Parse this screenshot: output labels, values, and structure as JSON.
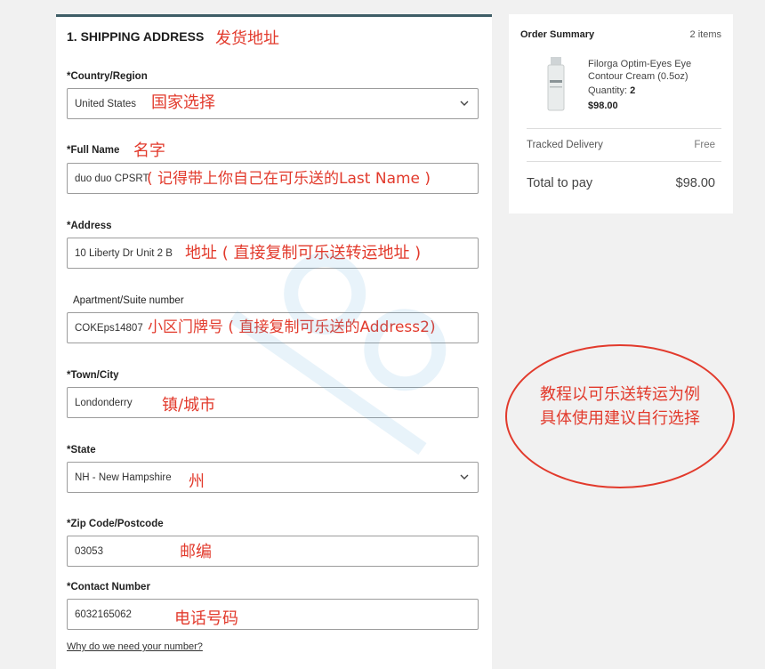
{
  "form": {
    "section_title": "1. SHIPPING ADDRESS",
    "country": {
      "label": "*Country/Region",
      "value": "United States"
    },
    "full_name": {
      "label": "*Full Name",
      "value": "duo duo  CPSRT"
    },
    "address": {
      "label": "*Address",
      "value": "10 Liberty Dr Unit 2 B"
    },
    "apartment": {
      "label": "Apartment/Suite number",
      "value": "COKEps14807"
    },
    "town": {
      "label": "*Town/City",
      "value": "Londonderry"
    },
    "state": {
      "label": "*State",
      "value": "NH - New Hampshire"
    },
    "zip": {
      "label": "*Zip Code/Postcode",
      "value": "03053"
    },
    "phone": {
      "label": "*Contact Number",
      "value": "6032165062"
    },
    "help_link": "Why do we need your number?"
  },
  "annotations": {
    "shipping": "发货地址",
    "country": "国家选择",
    "name": "名字",
    "name_hint": "( 记得带上你自己在可乐送的Last Name )",
    "address": "地址 ( 直接复制可乐送转运地址 )",
    "apartment": "小区门牌号 ( 直接复制可乐送的Address2)",
    "town": "镇/城市",
    "state": "州",
    "zip": "邮编",
    "phone": "电话号码",
    "oval_line1": "教程以可乐送转运为例",
    "oval_line2": "具体使用建议自行选择"
  },
  "summary": {
    "title": "Order Summary",
    "count": "2 items",
    "product_name": "Filorga Optim-Eyes Eye Contour Cream (0.5oz)",
    "quantity_label": "Quantity:",
    "quantity": "2",
    "price": "$98.00",
    "delivery_label": "Tracked Delivery",
    "delivery_value": "Free",
    "total_label": "Total to pay",
    "total_value": "$98.00"
  },
  "colors": {
    "accent": "#3e5d66",
    "annotation_red": "#e23a2c",
    "watermark_blue": "#4a9fd8"
  },
  "icons": [
    "chevron-down-icon",
    "product-bottle-icon",
    "watermark-logo"
  ]
}
